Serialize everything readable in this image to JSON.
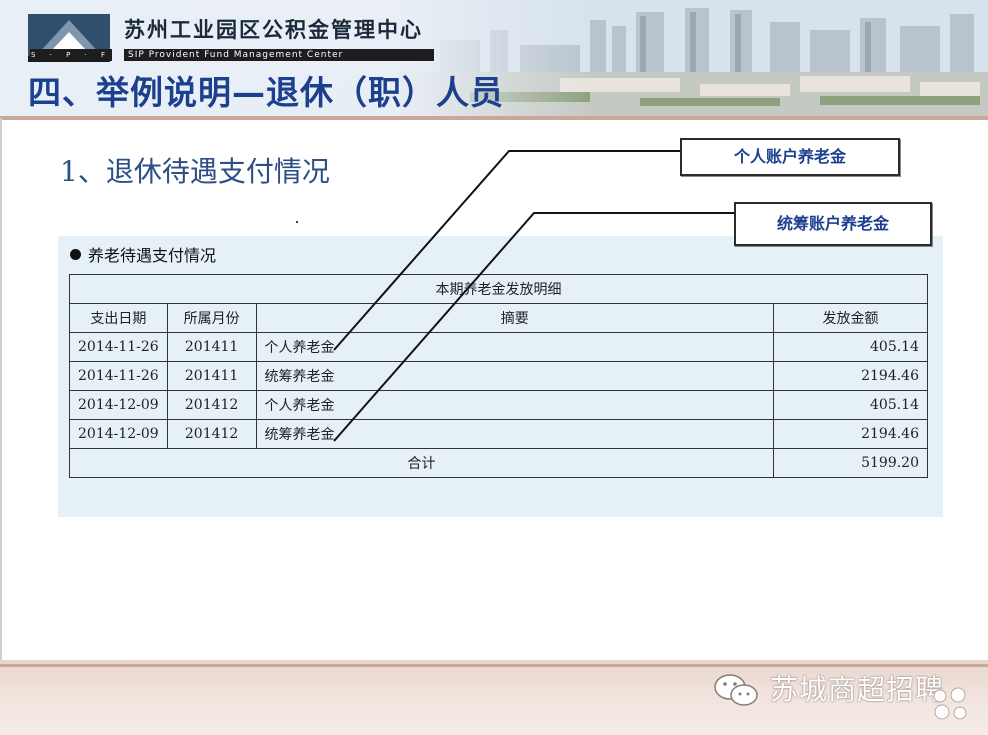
{
  "header": {
    "org_name_cn": "苏州工业园区公积金管理中心",
    "org_name_en": "SIP Provident Fund Management Center",
    "org_abbr": "S · P · F",
    "slide_title": "四、举例说明—退休（职）人员"
  },
  "subtitle": "1、退休待遇支付情况",
  "panel": {
    "heading": "养老待遇支付情况",
    "table_caption": "本期养老金发放明细",
    "columns": [
      "支出日期",
      "所属月份",
      "摘要",
      "发放金额"
    ],
    "rows": [
      {
        "date": "2014-11-26",
        "month": "201411",
        "summary": "个人养老金",
        "amount": "405.14"
      },
      {
        "date": "2014-11-26",
        "month": "201411",
        "summary": "统筹养老金",
        "amount": "2194.46"
      },
      {
        "date": "2014-12-09",
        "month": "201412",
        "summary": "个人养老金",
        "amount": "405.14"
      },
      {
        "date": "2014-12-09",
        "month": "201412",
        "summary": "统筹养老金",
        "amount": "2194.46"
      }
    ],
    "total_label": "合计",
    "total_amount": "5199.20"
  },
  "callouts": {
    "personal": "个人账户养老金",
    "pooled": "统筹账户养老金"
  },
  "watermark": {
    "text": "苏城商超招聘",
    "icon": "wechat-icon"
  },
  "colors": {
    "title_blue": "#1c3f8e",
    "subtitle_blue": "#2d4f86",
    "panel_bg": "#e5f1f7",
    "band": "#c9a79b"
  }
}
